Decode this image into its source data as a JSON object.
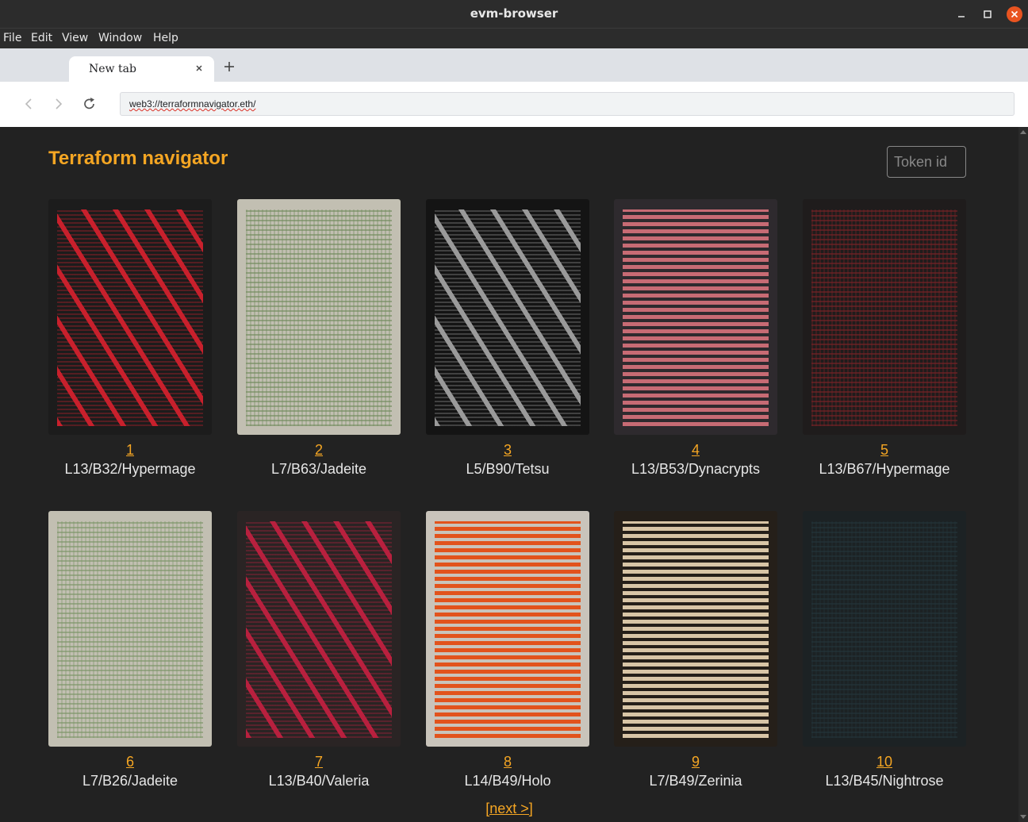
{
  "window": {
    "title": "evm-browser"
  },
  "menu": [
    "File",
    "Edit",
    "View",
    "Window",
    "Help"
  ],
  "tabs": [
    {
      "label": "New tab"
    }
  ],
  "address": {
    "url": "web3://terraformnavigator.eth/"
  },
  "page": {
    "heading": "Terraform navigator",
    "token_placeholder": "Token id",
    "next_label": "[next >]",
    "cards": [
      {
        "id": "1",
        "name": "L13/B32/Hypermage",
        "bg": "#1c1c1c",
        "fg": "#c8202c",
        "style": "diag"
      },
      {
        "id": "2",
        "name": "L7/B63/Jadeite",
        "bg": "#c2bfb2",
        "fg": "#6f8a5a",
        "style": "wave"
      },
      {
        "id": "3",
        "name": "L5/B90/Tetsu",
        "bg": "#141414",
        "fg": "#9a9a9a",
        "style": "diag"
      },
      {
        "id": "4",
        "name": "L13/B53/Dynacrypts",
        "bg": "#2e2a2e",
        "fg": "#c76b74",
        "style": "stripe"
      },
      {
        "id": "5",
        "name": "L13/B67/Hypermage",
        "bg": "#1f1c1c",
        "fg": "#7a2226",
        "style": "wave"
      },
      {
        "id": "6",
        "name": "L7/B26/Jadeite",
        "bg": "#c2bfb2",
        "fg": "#7a9466",
        "style": "wave"
      },
      {
        "id": "7",
        "name": "L13/B40/Valeria",
        "bg": "#2a2424",
        "fg": "#b8203e",
        "style": "diag"
      },
      {
        "id": "8",
        "name": "L14/B49/Holo",
        "bg": "#c9c4bb",
        "fg": "#e2531c",
        "style": "stripe"
      },
      {
        "id": "9",
        "name": "L7/B49/Zerinia",
        "bg": "#251f19",
        "fg": "#d8c5a6",
        "style": "stripe"
      },
      {
        "id": "10",
        "name": "L13/B45/Nightrose",
        "bg": "#1c2224",
        "fg": "#23343a",
        "style": "wave"
      }
    ]
  }
}
